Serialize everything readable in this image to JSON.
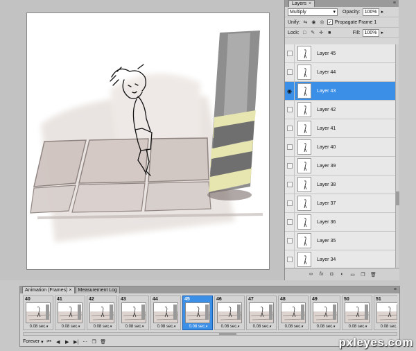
{
  "layers_panel": {
    "tab_label": "Layers",
    "close_glyph": "×",
    "blend_mode": "Multiply",
    "opacity_label": "Opacity:",
    "opacity_value": "100%",
    "unify_label": "Unify:",
    "propagate_label": "Propagate Frame 1",
    "lock_label": "Lock:",
    "fill_label": "Fill:",
    "fill_value": "100%",
    "layers": [
      {
        "name": "Layer 45",
        "visible": false,
        "active": false
      },
      {
        "name": "Layer 44",
        "visible": false,
        "active": false
      },
      {
        "name": "Layer 43",
        "visible": true,
        "active": true
      },
      {
        "name": "Layer 42",
        "visible": false,
        "active": false
      },
      {
        "name": "Layer 41",
        "visible": false,
        "active": false
      },
      {
        "name": "Layer 40",
        "visible": false,
        "active": false
      },
      {
        "name": "Layer 39",
        "visible": false,
        "active": false
      },
      {
        "name": "Layer 38",
        "visible": false,
        "active": false
      },
      {
        "name": "Layer 37",
        "visible": false,
        "active": false
      },
      {
        "name": "Layer 36",
        "visible": false,
        "active": false
      },
      {
        "name": "Layer 35",
        "visible": false,
        "active": false
      },
      {
        "name": "Layer 34",
        "visible": false,
        "active": false
      }
    ],
    "footer_icons": [
      "link-icon",
      "fx-icon",
      "mask-icon",
      "adjustment-icon",
      "group-icon",
      "new-layer-icon",
      "trash-icon"
    ]
  },
  "animation_panel": {
    "tabs": [
      "Animation (Frames)",
      "Measurement Log"
    ],
    "frames": [
      {
        "num": "40",
        "delay": "0.08 sec."
      },
      {
        "num": "41",
        "delay": "0.08 sec."
      },
      {
        "num": "42",
        "delay": "0.08 sec."
      },
      {
        "num": "43",
        "delay": "0.08 sec."
      },
      {
        "num": "44",
        "delay": "0.08 sec."
      },
      {
        "num": "45",
        "delay": "0.08 sec.",
        "active": true
      },
      {
        "num": "46",
        "delay": "0.08 sec."
      },
      {
        "num": "47",
        "delay": "0.08 sec."
      },
      {
        "num": "48",
        "delay": "0.08 sec."
      },
      {
        "num": "49",
        "delay": "0.08 sec."
      },
      {
        "num": "50",
        "delay": "0.08 sec."
      },
      {
        "num": "51",
        "delay": "0.08 sec."
      }
    ],
    "loop_value": "Forever",
    "controls": [
      "first-frame-icon",
      "previous-frame-icon",
      "play-icon",
      "next-frame-icon",
      "tween-icon",
      "duplicate-frame-icon",
      "delete-frame-icon"
    ]
  },
  "watermark": "pxleyes.com",
  "colors": {
    "selection": "#3c8fe6",
    "panel_bg": "#d6d6d6",
    "pillar_stripe": "#e8e6b0"
  }
}
